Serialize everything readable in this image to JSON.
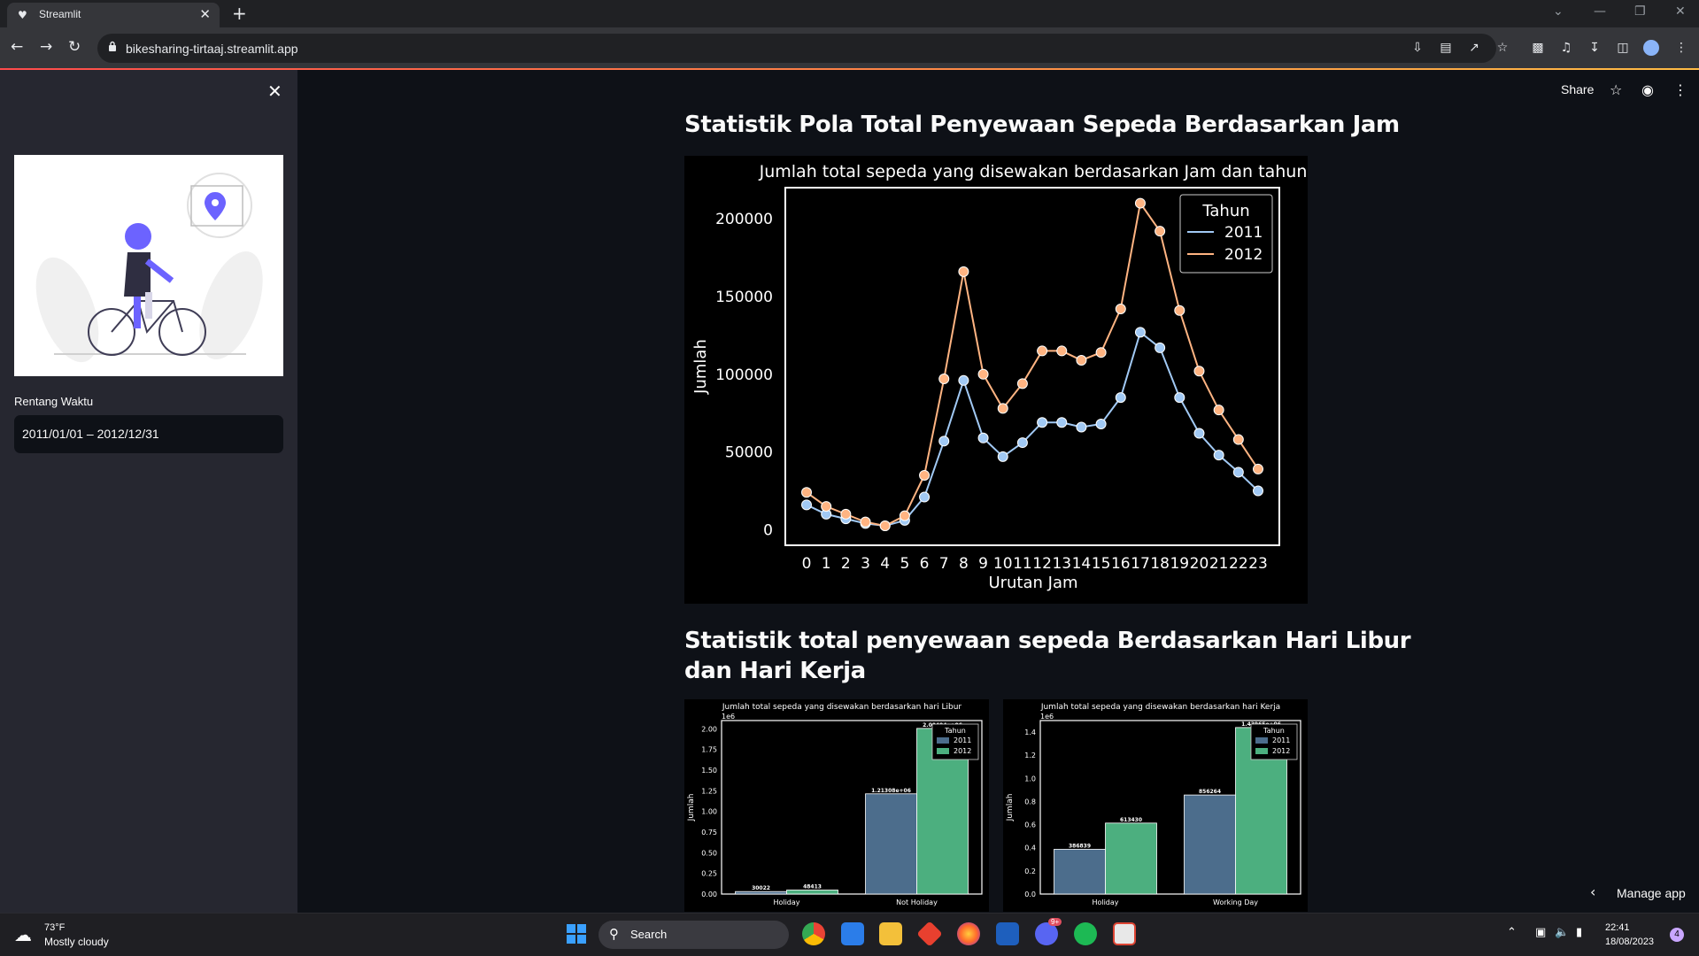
{
  "browser": {
    "tab_title": "Streamlit",
    "url": "bikesharing-tirtaaj.streamlit.app"
  },
  "sidebar": {
    "date_range_label": "Rentang Waktu",
    "date_range_value": "2011/01/01 – 2012/12/31"
  },
  "header": {
    "share_label": "Share"
  },
  "sections": {
    "hourly_title": "Statistik Pola Total Penyewaan Sepeda Berdasarkan Jam",
    "dayType_title_line1": "Statistik total penyewaan sepeda Berdasarkan Hari Libur",
    "dayType_title_line2": "dan Hari Kerja"
  },
  "manage_app": "Manage app",
  "taskbar": {
    "weather_temp": "73°F",
    "weather_desc": "Mostly cloudy",
    "search_label": "Search",
    "time": "22:41",
    "date": "18/08/2023",
    "notification_count": "4",
    "discord_badge": "9+"
  },
  "colors": {
    "series_2011": "#a1c9f4",
    "series_2012": "#ffb482",
    "bar_2011": "#4c6d8c",
    "bar_2012": "#4caf7f",
    "app_bg": "#0e1117",
    "sidebar_bg": "#262730"
  },
  "chart_data": [
    {
      "type": "line",
      "title": "Jumlah total sepeda yang disewakan berdasarkan Jam dan tahun",
      "xlabel": "Urutan Jam",
      "ylabel": "Jumlah",
      "x": [
        "0",
        "1",
        "2",
        "3",
        "4",
        "5",
        "6",
        "7",
        "8",
        "9",
        "10",
        "11",
        "12",
        "13",
        "14",
        "15",
        "16",
        "17",
        "18",
        "19",
        "20",
        "21",
        "22",
        "23"
      ],
      "ylim": [
        -10000,
        220000
      ],
      "yticks": [
        "0",
        "50000",
        "100000",
        "150000",
        "200000"
      ],
      "legend_title": "Tahun",
      "legend_position": "top-right",
      "series": [
        {
          "name": "2011",
          "values": [
            16000,
            10000,
            7000,
            4000,
            2500,
            6000,
            21000,
            57000,
            96000,
            59000,
            47000,
            56000,
            69000,
            69000,
            66000,
            68000,
            85000,
            127000,
            117000,
            85000,
            62000,
            48000,
            37000,
            25000
          ]
        },
        {
          "name": "2012",
          "values": [
            24000,
            15000,
            10000,
            5000,
            2500,
            9000,
            35000,
            97000,
            166000,
            100000,
            78000,
            94000,
            115000,
            115000,
            109000,
            114000,
            142000,
            210000,
            192000,
            141000,
            102000,
            77000,
            58000,
            39000
          ]
        }
      ]
    },
    {
      "type": "bar",
      "title": "Jumlah total sepeda yang disewakan berdasarkan hari Libur",
      "ylabel": "Jumlah",
      "y_scale_label": "1e6",
      "categories": [
        "Holiday",
        "Not Holiday"
      ],
      "ylim": [
        0,
        2.1
      ],
      "yticks": [
        "0.00",
        "0.25",
        "0.50",
        "0.75",
        "1.00",
        "1.25",
        "1.50",
        "1.75",
        "2.00"
      ],
      "legend_title": "Tahun",
      "legend_position": "top-right",
      "series": [
        {
          "name": "2011",
          "values": [
            0.030022,
            1.21308
          ],
          "labels": [
            "30022",
            "1.21308e+06"
          ]
        },
        {
          "name": "2012",
          "values": [
            0.048413,
            2.00494
          ],
          "labels": [
            "48413",
            "2.00494e+06"
          ]
        }
      ]
    },
    {
      "type": "bar",
      "title": "Jumlah total sepeda yang disewakan berdasarkan hari Kerja",
      "ylabel": "Jumlah",
      "y_scale_label": "1e6",
      "categories": [
        "Holiday",
        "Working Day"
      ],
      "ylim": [
        0,
        1.5
      ],
      "yticks": [
        "0.0",
        "0.2",
        "0.4",
        "0.6",
        "0.8",
        "1.0",
        "1.2",
        "1.4"
      ],
      "legend_title": "Tahun",
      "legend_position": "top-right",
      "series": [
        {
          "name": "2011",
          "values": [
            0.386839,
            0.856264
          ],
          "labels": [
            "386839",
            "856264"
          ]
        },
        {
          "name": "2012",
          "values": [
            0.61343,
            1.43965
          ],
          "labels": [
            "613430",
            "1.43965e+06"
          ]
        }
      ]
    }
  ]
}
